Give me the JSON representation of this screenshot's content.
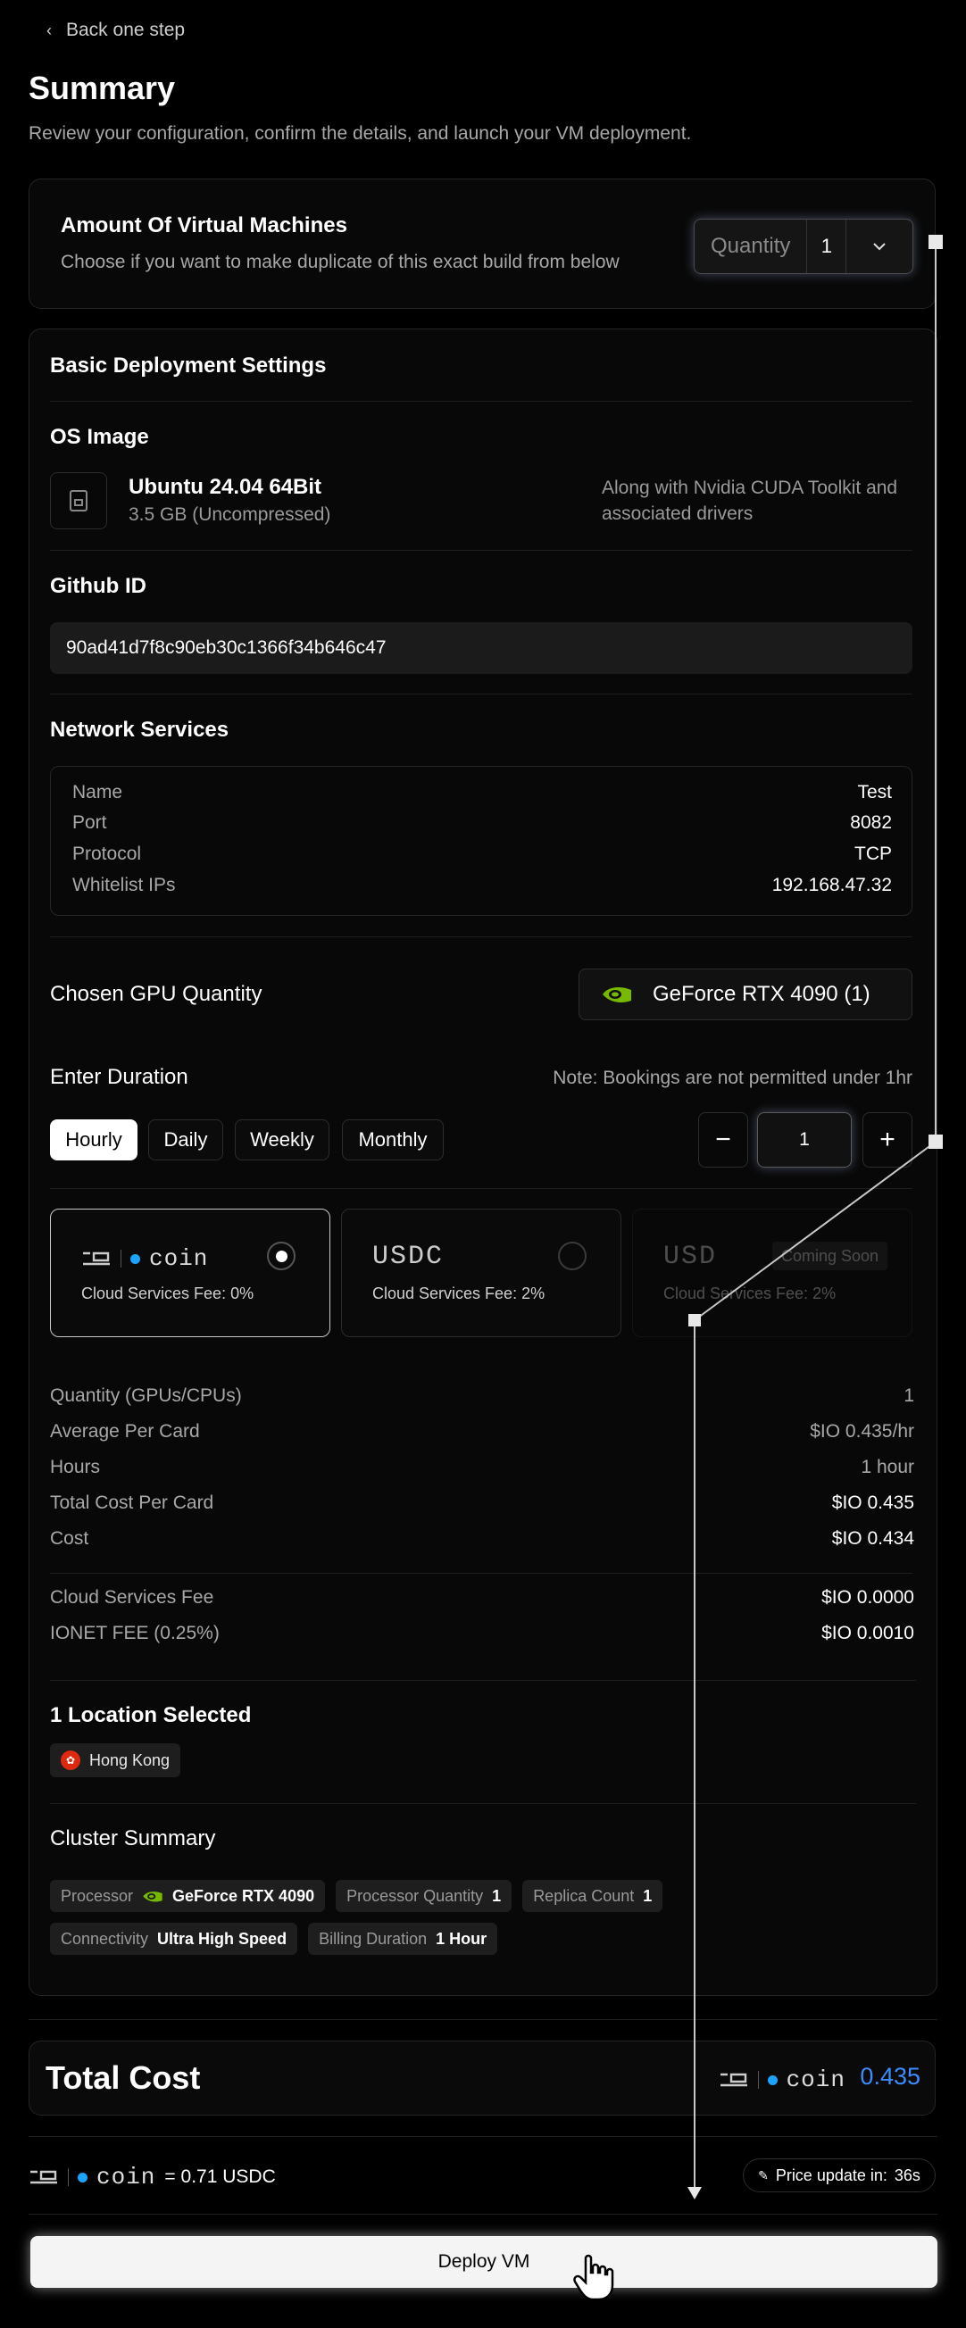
{
  "nav": {
    "back_label": "Back one step"
  },
  "header": {
    "title": "Summary",
    "subtitle": "Review your configuration, confirm the details, and launch your VM deployment."
  },
  "vm_amount": {
    "title": "Amount Of Virtual Machines",
    "description": "Choose if you want to make duplicate of this exact build from below",
    "quantity_label": "Quantity",
    "quantity_value": "1"
  },
  "basic": {
    "title": "Basic Deployment Settings",
    "os_image_title": "OS Image",
    "os_name": "Ubuntu 24.04 64Bit",
    "os_size": "3.5 GB (Uncompressed)",
    "os_note": "Along with Nvidia CUDA Toolkit and associated drivers",
    "github_title": "Github ID",
    "github_value": "90ad41d7f8c90eb30c1366f34b646c47",
    "network_title": "Network Services",
    "network_rows": [
      {
        "label": "Name",
        "value": "Test"
      },
      {
        "label": "Port",
        "value": "8082"
      },
      {
        "label": "Protocol",
        "value": "TCP"
      },
      {
        "label": "Whitelist IPs",
        "value": "192.168.47.32"
      }
    ],
    "gpu_title": "Chosen GPU Quantity",
    "gpu_value": "GeForce RTX 4090 (1)"
  },
  "duration": {
    "title": "Enter Duration",
    "note": "Note: Bookings are not permitted under 1hr",
    "options": [
      "Hourly",
      "Daily",
      "Weekly",
      "Monthly"
    ],
    "selected": "Hourly",
    "minus": "−",
    "plus": "+",
    "value": "1"
  },
  "payment": {
    "options": [
      {
        "name": "IO COIN",
        "logo_text": "coin",
        "fee": "Cloud Services Fee: 0%",
        "selected": true
      },
      {
        "name": "USDC",
        "logo_text": "USDC",
        "fee": "Cloud Services Fee: 2%",
        "selected": false
      },
      {
        "name": "USD",
        "logo_text": "USD",
        "fee": "Cloud Services Fee: 2%",
        "badge": "Coming Soon",
        "disabled": true
      }
    ]
  },
  "costs": {
    "rows": [
      {
        "label": "Quantity (GPUs/CPUs)",
        "value": "1"
      },
      {
        "label": "Average Per Card",
        "value": "$IO 0.435/hr"
      },
      {
        "label": "Hours",
        "value": "1 hour"
      },
      {
        "label": "Total Cost Per Card",
        "value": "$IO 0.435"
      },
      {
        "label": "Cost",
        "value": "$IO 0.434"
      }
    ],
    "fees": [
      {
        "label": "Cloud Services Fee",
        "value": "$IO 0.0000"
      },
      {
        "label": "IONET FEE (0.25%)",
        "value": "$IO 0.0010"
      }
    ]
  },
  "location": {
    "title": "1 Location Selected",
    "item": "Hong Kong"
  },
  "cluster": {
    "title": "Cluster Summary",
    "processor_label": "Processor",
    "processor_value": "GeForce RTX 4090",
    "proc_qty_label": "Processor Quantity",
    "proc_qty_value": "1",
    "replica_label": "Replica Count",
    "replica_value": "1",
    "connectivity_label": "Connectivity",
    "connectivity_value": "Ultra High Speed",
    "billing_label": "Billing Duration",
    "billing_value": "1 Hour"
  },
  "total": {
    "label": "Total Cost",
    "value": "0.435",
    "coin_text": "coin"
  },
  "rate": {
    "text": "= 0.71 USDC",
    "coin_text": "coin",
    "update_label": "Price update in:",
    "update_value": "36s"
  },
  "deploy": {
    "label": "Deploy VM"
  },
  "colors": {
    "accent_blue": "#3b8cff",
    "nvidia_green": "#76b900",
    "coin_dot": "#1aa3ff",
    "hk_red": "#de2910"
  }
}
